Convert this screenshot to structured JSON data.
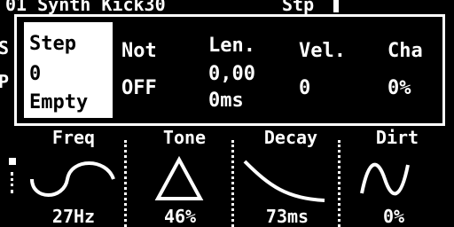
{
  "header": {
    "track": "01 Synth Kick30",
    "mode": "Stp"
  },
  "side_letters": [
    "S",
    "P"
  ],
  "macros": [
    {
      "label": "Freq",
      "value": "27Hz"
    },
    {
      "label": "Tone",
      "value": "46%"
    },
    {
      "label": "Decay",
      "value": "73ms"
    },
    {
      "label": "Dirt",
      "value": "0%"
    }
  ],
  "popup": {
    "step_label": "Step",
    "step_number": "0",
    "step_state": "Empty",
    "fields": [
      {
        "label": "Not",
        "value": "OFF"
      },
      {
        "label": "Len.",
        "value": "0,00",
        "value2": "0ms"
      },
      {
        "label": "Vel.",
        "value": "0"
      },
      {
        "label": "Cha",
        "value": "0%"
      }
    ]
  }
}
